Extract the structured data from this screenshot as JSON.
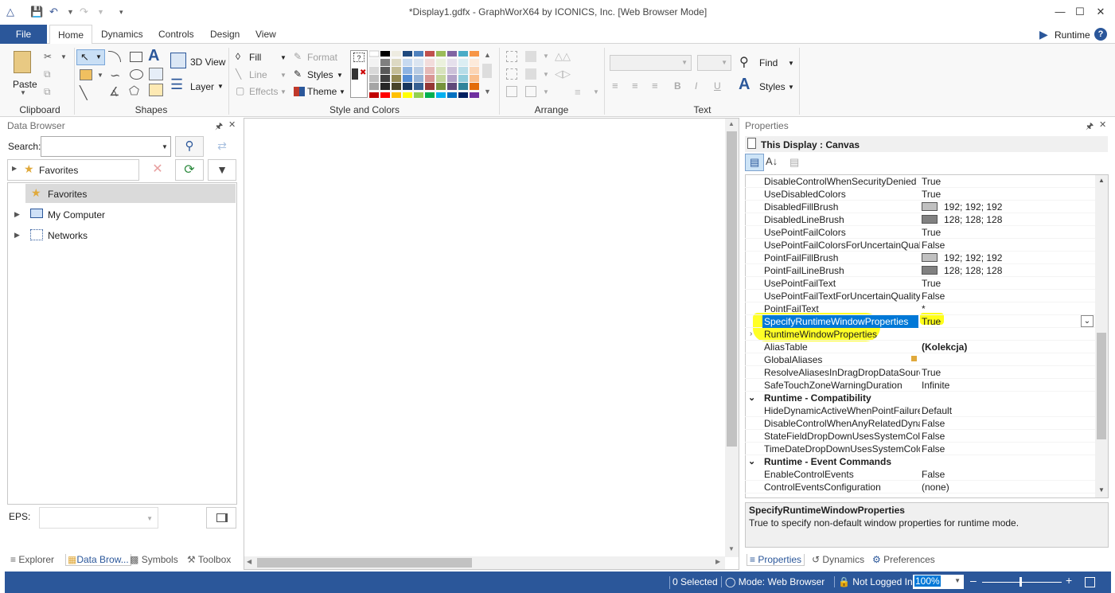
{
  "window": {
    "title": "*Display1.gdfx - GraphWorX64 by ICONICS, Inc. [Web Browser Mode]",
    "minimize": "—",
    "maximize": "☐",
    "close": "✕"
  },
  "ribbon": {
    "file_tab": "File",
    "tabs": [
      "Home",
      "Dynamics",
      "Controls",
      "Design",
      "View"
    ],
    "runtime_label": "Runtime",
    "help_label": "?",
    "groups": {
      "clipboard": "Clipboard",
      "shapes": "Shapes",
      "style_colors": "Style and Colors",
      "arrange": "Arrange",
      "text": "Text"
    },
    "paste": "Paste",
    "view3d": "3D View",
    "layer": "Layer",
    "fill": "Fill",
    "line": "Line",
    "effects": "Effects",
    "format": "Format",
    "styles": "Styles",
    "theme": "Theme",
    "find": "Find",
    "text_styles": "Styles",
    "bold": "B",
    "italic": "I",
    "underline": "U"
  },
  "data_browser": {
    "title": "Data Browser",
    "search_label": "Search:",
    "search_value": "",
    "favorites_combo": "Favorites",
    "tree": [
      {
        "label": "Favorites",
        "selected": true
      },
      {
        "label": "My Computer",
        "selected": false
      },
      {
        "label": "Networks",
        "selected": false
      }
    ],
    "eps_label": "EPS:",
    "bottom_tabs": [
      "Explorer",
      "Data Brow...",
      "Symbols",
      "Toolbox"
    ]
  },
  "properties": {
    "title": "Properties",
    "object": "This Display : Canvas",
    "rows": [
      {
        "kind": "prop",
        "name": "DisableControlWhenSecurityDenied",
        "value": "True"
      },
      {
        "kind": "prop",
        "name": "UseDisabledColors",
        "value": "True"
      },
      {
        "kind": "prop",
        "name": "DisabledFillBrush",
        "value": "192; 192; 192",
        "swatch": "#c0c0c0"
      },
      {
        "kind": "prop",
        "name": "DisabledLineBrush",
        "value": "128; 128; 128",
        "swatch": "#808080"
      },
      {
        "kind": "prop",
        "name": "UsePointFailColors",
        "value": "True"
      },
      {
        "kind": "prop",
        "name": "UsePointFailColorsForUncertainQuality",
        "value": "False"
      },
      {
        "kind": "prop",
        "name": "PointFailFillBrush",
        "value": "192; 192; 192",
        "swatch": "#c0c0c0"
      },
      {
        "kind": "prop",
        "name": "PointFailLineBrush",
        "value": "128; 128; 128",
        "swatch": "#808080"
      },
      {
        "kind": "prop",
        "name": "UsePointFailText",
        "value": "True"
      },
      {
        "kind": "prop",
        "name": "UsePointFailTextForUncertainQuality",
        "value": "False"
      },
      {
        "kind": "prop",
        "name": "PointFailText",
        "value": "*"
      },
      {
        "kind": "prop",
        "name": "SpecifyRuntimeWindowProperties",
        "value": "True",
        "selected": true
      },
      {
        "kind": "prop",
        "name": "RuntimeWindowProperties",
        "value": "",
        "expandable": true
      },
      {
        "kind": "prop",
        "name": "AliasTable",
        "value": "(Kolekcja)",
        "bold": true
      },
      {
        "kind": "prop",
        "name": "GlobalAliases",
        "value": ""
      },
      {
        "kind": "prop",
        "name": "ResolveAliasesInDragDropDataSource",
        "value": "True"
      },
      {
        "kind": "prop",
        "name": "SafeTouchZoneWarningDuration",
        "value": "Infinite"
      },
      {
        "kind": "cat",
        "name": "Runtime - Compatibility"
      },
      {
        "kind": "prop",
        "name": "HideDynamicActiveWhenPointFailureEx",
        "value": "Default"
      },
      {
        "kind": "prop",
        "name": "DisableControlWhenAnyRelatedDynamics",
        "value": "False"
      },
      {
        "kind": "prop",
        "name": "StateFieldDropDownUsesSystemColors",
        "value": "False"
      },
      {
        "kind": "prop",
        "name": "TimeDateDropDownUsesSystemColors",
        "value": "False"
      },
      {
        "kind": "cat",
        "name": "Runtime - Event Commands"
      },
      {
        "kind": "prop",
        "name": "EnableControlEvents",
        "value": "False"
      },
      {
        "kind": "prop",
        "name": "ControlEventsConfiguration",
        "value": "(none)"
      }
    ],
    "desc_title": "SpecifyRuntimeWindowProperties",
    "desc_text": "True to specify non-default window properties for runtime mode.",
    "bottom_tabs": [
      "Properties",
      "Dynamics",
      "Preferences"
    ]
  },
  "status": {
    "selected": "0 Selected",
    "mode": "Mode: Web Browser",
    "login": "Not Logged In",
    "zoom": "100%"
  },
  "colors": {
    "accent": "#2b579a",
    "selection": "#0078d7",
    "highlight": "#ffff00"
  }
}
